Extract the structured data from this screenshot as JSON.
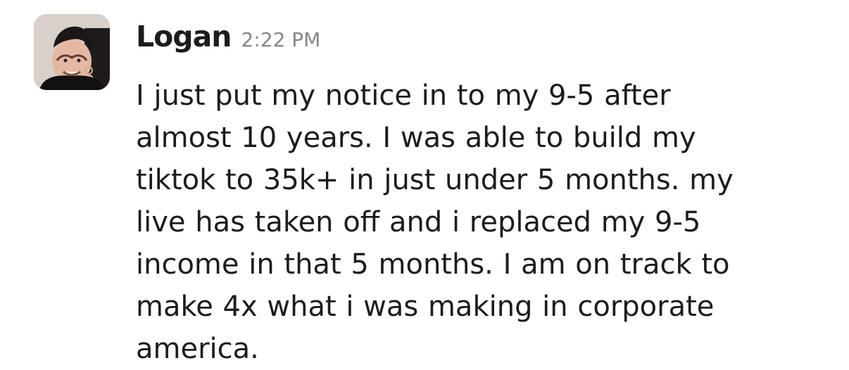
{
  "message": {
    "sender": "Logan",
    "timestamp": "2:22 PM",
    "avatar": {
      "icon": "user-avatar-photo",
      "description": "profile photo"
    },
    "text_lines": [
      "I just put my notice in to my 9-5 after",
      "almost 10 years. I was able to build my",
      "tiktok to 35k+ in just under 5 months. my",
      "live has taken off and i replaced my 9-5",
      "income in that 5 months. I am on track to",
      "make 4x what i was making in corporate",
      "america."
    ]
  },
  "colors": {
    "sender": "#1d1c1d",
    "timestamp": "#868686",
    "text": "#1d1c1d",
    "background": "#ffffff"
  }
}
